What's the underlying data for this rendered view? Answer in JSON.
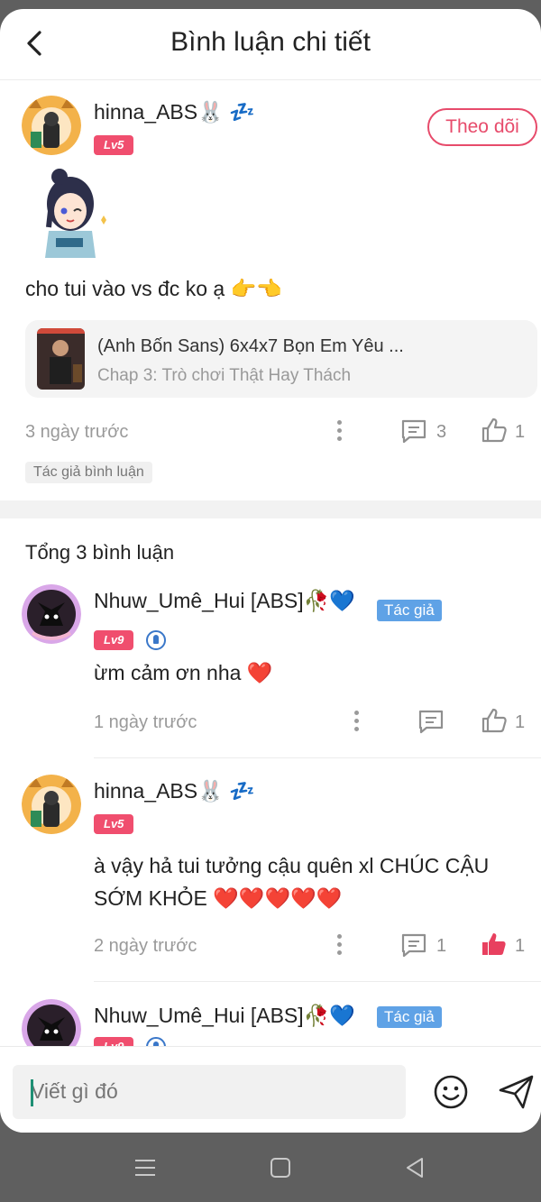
{
  "header": {
    "title": "Bình luận chi tiết"
  },
  "post": {
    "username": "hinna_ABS🐰 💤",
    "level": "Lv5",
    "follow_label": "Theo dõi",
    "text": "cho tui vào vs đc ko ạ 👉👈",
    "chapter": {
      "title": "(Anh Bốn Sans) 6x4x7 Bọn Em Yêu ...",
      "subtitle": "Chap 3: Trò chơi Thật Hay Thách"
    },
    "time": "3 ngày trước",
    "reply_count": "3",
    "like_count": "1",
    "tag": "Tác giả bình luận"
  },
  "comments_section": {
    "title": "Tổng 3 bình luận",
    "comments": [
      {
        "username": "Nhuw_Umê_Hui [ABS]🥀💙",
        "author_tag": "Tác giả",
        "level": "Lv9",
        "text": "ừm cảm ơn nha ❤️",
        "time": "1 ngày trước",
        "reply_count": "",
        "like_count": "1"
      },
      {
        "username": "hinna_ABS🐰 💤",
        "level": "Lv5",
        "text_line1": "à vậy hả tui tưởng cậu quên xl CHÚC CẬU",
        "text_line2": "SỚM KHỎE ❤️❤️❤️❤️❤️",
        "time": "2 ngày trước",
        "reply_count": "1",
        "like_count": "1"
      },
      {
        "username": "Nhuw_Umê_Hui [ABS]🥀💙",
        "author_tag": "Tác giả",
        "level": "Lv9"
      }
    ]
  },
  "composer": {
    "placeholder": "Viết gì đó"
  },
  "colors": {
    "accent": "#e74b6b",
    "author_tag": "#5fa2e6",
    "liked": "#e8405f"
  },
  "icons": [
    "back-arrow-icon",
    "more-dots-icon",
    "reply-icon",
    "thumbs-up-icon",
    "emoji-icon",
    "send-icon",
    "menu-icon",
    "home-icon",
    "back-triangle-icon"
  ]
}
